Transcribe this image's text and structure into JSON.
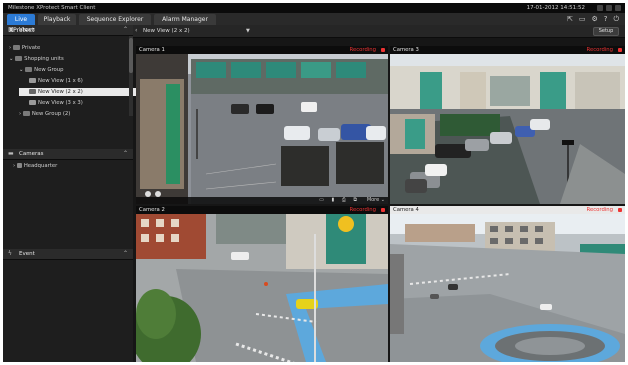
{
  "window": {
    "title": "Milestone XProtect Smart Client",
    "clock": "17-01-2012 14:51:52"
  },
  "tabs": [
    {
      "label": "Live",
      "active": true
    },
    {
      "label": "Playback",
      "active": false
    },
    {
      "label": "Sequence Explorer",
      "active": false
    },
    {
      "label": "Alarm Manager",
      "active": false
    }
  ],
  "header": {
    "brand": "XProtect",
    "nav_prev": "‹",
    "view_name": "New View (2 x 2)",
    "dropdown": "▼",
    "setup_label": "Setup"
  },
  "panes": {
    "views": {
      "title": "Views"
    },
    "cameras": {
      "title": "Cameras"
    },
    "event": {
      "title": "Event"
    }
  },
  "views_tree": [
    {
      "label": "Private",
      "expander": "›"
    },
    {
      "label": "Shopping units",
      "expander": "⌄"
    },
    {
      "label": "New Group",
      "expander": "⌄"
    },
    {
      "label": "New View (1 x 6)",
      "expander": ""
    },
    {
      "label": "New View (2 x 2)",
      "expander": "",
      "selected": true
    },
    {
      "label": "New View (3 x 3)",
      "expander": ""
    },
    {
      "label": "New Group (2)",
      "expander": "›"
    }
  ],
  "cameras_tree": [
    {
      "label": "Headquarter",
      "expander": "›"
    }
  ],
  "grid": [
    {
      "name": "Camera 1",
      "status": "Recording"
    },
    {
      "name": "Camera 3",
      "status": "Recording"
    },
    {
      "name": "Camera 2",
      "status": "Recording"
    },
    {
      "name": "Camera 4",
      "status": "Recording"
    }
  ],
  "camera_toolbar": {
    "icons": "▭ ▮ ⎙ ⧉",
    "more_label": "More ⌄"
  },
  "colors": {
    "accent": "#2c7bd6",
    "recording": "#e33333",
    "panel": "#1e1e1e"
  }
}
